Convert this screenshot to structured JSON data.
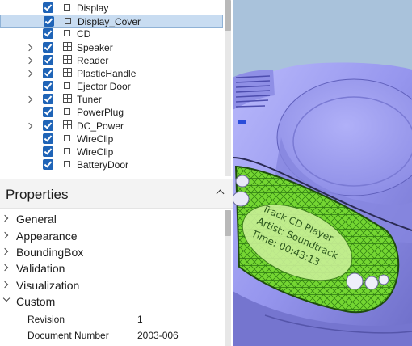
{
  "tree": {
    "items": [
      {
        "label": "Display",
        "expandable": false,
        "checked": true,
        "icon": "part-icon",
        "selected": false
      },
      {
        "label": "Display_Cover",
        "expandable": false,
        "checked": true,
        "icon": "part-icon",
        "selected": true
      },
      {
        "label": "CD",
        "expandable": false,
        "checked": true,
        "icon": "part-icon",
        "selected": false
      },
      {
        "label": "Speaker",
        "expandable": true,
        "checked": true,
        "icon": "assembly-icon",
        "selected": false
      },
      {
        "label": "Reader",
        "expandable": true,
        "checked": true,
        "icon": "assembly-icon",
        "selected": false
      },
      {
        "label": "PlasticHandle",
        "expandable": true,
        "checked": true,
        "icon": "assembly-icon",
        "selected": false
      },
      {
        "label": "Ejector Door",
        "expandable": false,
        "checked": true,
        "icon": "part-icon",
        "selected": false
      },
      {
        "label": "Tuner",
        "expandable": true,
        "checked": true,
        "icon": "assembly-icon",
        "selected": false
      },
      {
        "label": "PowerPlug",
        "expandable": false,
        "checked": true,
        "icon": "part-icon",
        "selected": false
      },
      {
        "label": "DC_Power",
        "expandable": true,
        "checked": true,
        "icon": "assembly-icon",
        "selected": false
      },
      {
        "label": "WireClip",
        "expandable": false,
        "checked": true,
        "icon": "part-icon",
        "selected": false
      },
      {
        "label": "WireClip",
        "expandable": false,
        "checked": true,
        "icon": "part-icon",
        "selected": false
      },
      {
        "label": "BatteryDoor",
        "expandable": false,
        "checked": true,
        "icon": "part-icon",
        "selected": false
      }
    ]
  },
  "properties": {
    "title": "Properties",
    "categories": [
      {
        "label": "General",
        "expanded": false
      },
      {
        "label": "Appearance",
        "expanded": false
      },
      {
        "label": "BoundingBox",
        "expanded": false
      },
      {
        "label": "Validation",
        "expanded": false
      },
      {
        "label": "Visualization",
        "expanded": false
      },
      {
        "label": "Custom",
        "expanded": true
      }
    ],
    "custom_rows": [
      {
        "name": "Revision",
        "value": "1"
      },
      {
        "name": "Document Number",
        "value": "2003-006"
      }
    ]
  },
  "viewport": {
    "display_lines": [
      "Track CD Player",
      "Artist: Soundtrack",
      "Time: 00:43:13"
    ]
  },
  "colors": {
    "selection": "#c8dcf1",
    "checkbox": "#1f64b7",
    "model_body": "#9c9cf0",
    "highlight_green": "#7ddc3a",
    "viewport_bg": "#a9c2db"
  }
}
